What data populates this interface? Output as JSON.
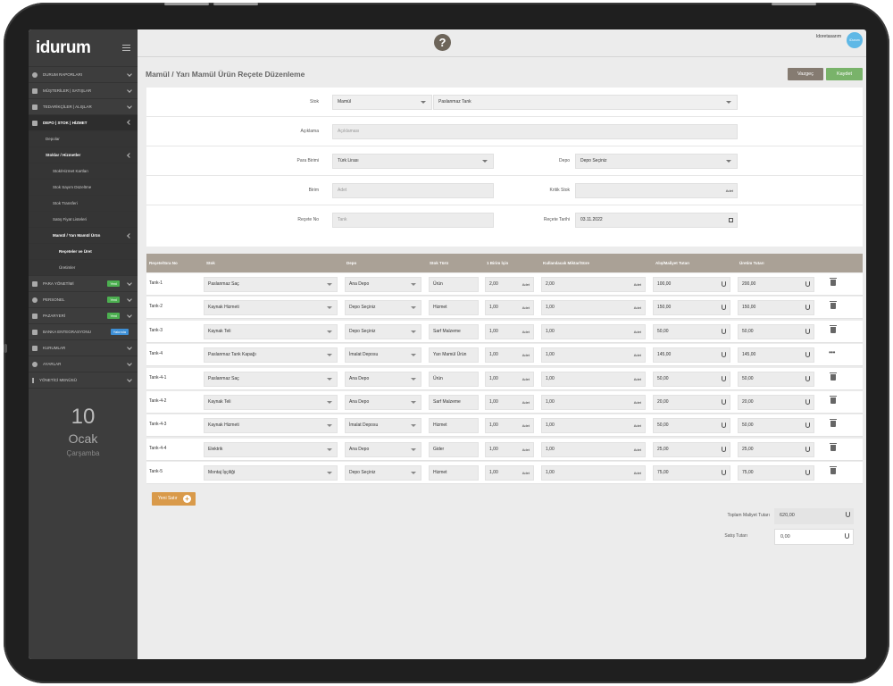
{
  "app": {
    "logo": "idurum",
    "user_name": "Idoretasarım",
    "avatar_text": "iDurum"
  },
  "sidebar": {
    "items": [
      {
        "label": "DURUM RAPORLARI"
      },
      {
        "label": "MÜŞTERİLER | SATIŞLAR"
      },
      {
        "label": "TEDARİKÇİLER | ALIŞLAR"
      },
      {
        "label": "DEPO | STOK | HİZMET"
      }
    ],
    "depo_sub": {
      "depolar": "Depolar",
      "stoklar": "Stoklar / Hizmetler",
      "stok_kartlari": "Stok/Hizmet Kartları",
      "sayim": "Stok Sayım Düzeltme",
      "transfer": "Stok Transferi",
      "fiyat": "Satış Fiyat Listeleri",
      "mamul": "Mamül / Yarı Mamül Ürün",
      "receteler": "Reçeteler ve Üret",
      "uretimler": "Üretimler"
    },
    "items2": [
      {
        "label": "PARA YÖNETİMİ",
        "badge": "Yeni"
      },
      {
        "label": "PERSONEL",
        "badge": "Yeni"
      },
      {
        "label": "PAZARYERİ",
        "badge": "Yeni"
      },
      {
        "label": "BANKA ENTEGRASYONU",
        "badge": "Yakında"
      },
      {
        "label": "KURUMLAR"
      },
      {
        "label": "AYARLAR"
      },
      {
        "label": "YÖNETİCİ MENÜSÜ"
      }
    ],
    "date": {
      "day": "10",
      "month": "Ocak",
      "weekday": "Çarşamba"
    }
  },
  "page": {
    "title": "Mamül / Yarı Mamül Ürün Reçete Düzenleme",
    "cancel": "Vazgeç",
    "save": "Kaydet"
  },
  "form": {
    "stok_label": "Stok",
    "stok_type": "Mamül",
    "stok_name": "Paslanmaz Tank",
    "aciklama_label": "Açıklama",
    "aciklama_placeholder": "Açıklaması",
    "para_label": "Para Birimi",
    "para_value": "Türk Lirası",
    "depo_label": "Depo",
    "depo_value": "Depo Seçiniz",
    "birim_label": "Birim",
    "birim_value": "Adet",
    "kritik_label": "Kritik Stok",
    "kritik_unit": "Adet",
    "recete_label": "Reçete No",
    "recete_value": "Tank",
    "tarih_label": "Reçete Tarihi",
    "tarih_value": "03.11.2022"
  },
  "table": {
    "headers": [
      "Reçete/Sıra No",
      "Stok",
      "Depo",
      "Stok Türü",
      "1 Birim İçin",
      "Kullanılacak Miktar/Süre",
      "Alış/Maliyet Tutarı",
      "Üretim Tutarı"
    ],
    "unit": "Adet",
    "rows": [
      {
        "no": "Tank-1",
        "stok": "Paslanmaz Saç",
        "depo": "Ana Depo",
        "tur": "Ürün",
        "birim": "2,00",
        "miktar": "2,00",
        "maliyet": "100,00",
        "uretim": "200,00",
        "action": "trash"
      },
      {
        "no": "Tank-2",
        "stok": "Kaynak Hizmeti",
        "depo": "Depo Seçiniz",
        "tur": "Hizmet",
        "birim": "1,00",
        "miktar": "1,00",
        "maliyet": "150,00",
        "uretim": "150,00",
        "action": "trash"
      },
      {
        "no": "Tank-3",
        "stok": "Kaynak Teli",
        "depo": "Depo Seçiniz",
        "tur": "Sarf Malzeme",
        "birim": "1,00",
        "miktar": "1,00",
        "maliyet": "50,00",
        "uretim": "50,00",
        "action": "trash"
      },
      {
        "no": "Tank-4",
        "stok": "Paslanmaz Tank Kapağı",
        "depo": "İmalat Deposu",
        "tur": "Yarı Mamül Ürün",
        "birim": "1,00",
        "miktar": "1,00",
        "maliyet": "145,00",
        "uretim": "145,00",
        "action": "dots"
      },
      {
        "no": "Tank-4-1",
        "stok": "Paslanmaz Saç",
        "depo": "Ana Depo",
        "tur": "Ürün",
        "birim": "1,00",
        "miktar": "1,00",
        "maliyet": "50,00",
        "uretim": "50,00",
        "action": "trash"
      },
      {
        "no": "Tank-4-2",
        "stok": "Kaynak Teli",
        "depo": "Ana Depo",
        "tur": "Sarf Malzeme",
        "birim": "1,00",
        "miktar": "1,00",
        "maliyet": "20,00",
        "uretim": "20,00",
        "action": "trash"
      },
      {
        "no": "Tank-4-3",
        "stok": "Kaynak Hizmeti",
        "depo": "İmalat Deposu",
        "tur": "Hizmet",
        "birim": "1,00",
        "miktar": "1,00",
        "maliyet": "50,00",
        "uretim": "50,00",
        "action": "trash"
      },
      {
        "no": "Tank-4-4",
        "stok": "Elektrik",
        "depo": "Ana Depo",
        "tur": "Gider",
        "birim": "1,00",
        "miktar": "1,00",
        "maliyet": "25,00",
        "uretim": "25,00",
        "action": "trash"
      },
      {
        "no": "Tank-5",
        "stok": "Montaj İşçiliği",
        "depo": "Depo Seçiniz",
        "tur": "Hizmet",
        "birim": "1,00",
        "miktar": "1,00",
        "maliyet": "75,00",
        "uretim": "75,00",
        "action": "trash"
      }
    ]
  },
  "footer": {
    "add_row": "Yeni Satır",
    "toplam_label": "Toplam Maliyet Tutarı",
    "toplam_value": "620,00",
    "satis_label": "Satış Tutarı",
    "satis_value": "0,00"
  },
  "colors": {
    "header": "#aaa196",
    "cancel": "#857b71",
    "save": "#79b36a",
    "add": "#d99a4a",
    "badge_new": "#4caf50",
    "badge_soon": "#3d8fd6"
  }
}
